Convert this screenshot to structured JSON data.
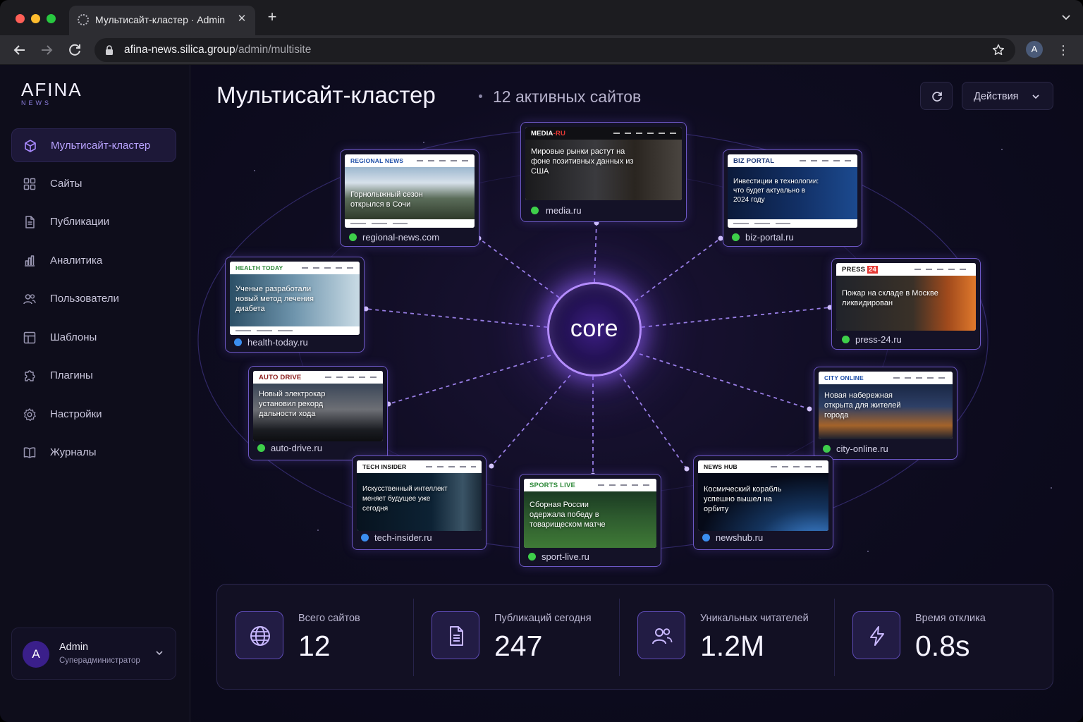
{
  "browser": {
    "tab_title": "Мультисайт-кластер · Admin",
    "url_host": "afina-news.silica.group",
    "url_path": "/admin/multisite",
    "profile_initial": "A"
  },
  "sidebar": {
    "logo": "AFINA",
    "logo_sub": "NEWS",
    "items": [
      {
        "label": "Мультисайт-кластер",
        "icon": "cube-icon",
        "active": true
      },
      {
        "label": "Сайты",
        "icon": "grid-icon"
      },
      {
        "label": "Публикации",
        "icon": "document-icon"
      },
      {
        "label": "Аналитика",
        "icon": "bar-chart-icon"
      },
      {
        "label": "Пользователи",
        "icon": "users-icon"
      },
      {
        "label": "Шаблоны",
        "icon": "layout-icon"
      },
      {
        "label": "Плагины",
        "icon": "puzzle-icon"
      },
      {
        "label": "Настройки",
        "icon": "gear-icon"
      },
      {
        "label": "Журналы",
        "icon": "book-icon"
      }
    ],
    "user": {
      "initial": "A",
      "name": "Admin",
      "role": "Суперадминистратор"
    }
  },
  "header": {
    "title": "Мультисайт-кластер",
    "subtitle": "12 активных сайтов",
    "actions_label": "Действия"
  },
  "cluster": {
    "core_label": "core",
    "sites": [
      {
        "brand": "MEDIA",
        "brand_suffix": "-RU",
        "headline": "Мировые рынки растут на фоне позитивных данных из США",
        "domain": "media.ru",
        "status": "green"
      },
      {
        "brand": "REGIONAL NEWS",
        "headline": "Горнолыжный сезон открылся в Сочи",
        "domain": "regional-news.com",
        "status": "green"
      },
      {
        "brand": "BIZ PORTAL",
        "headline": "Инвестиции в технологии: что будет актуально в 2024 году",
        "domain": "biz-portal.ru",
        "status": "green"
      },
      {
        "brand": "HEALTH TODAY",
        "headline": "Ученые разработали новый метод лечения диабета",
        "domain": "health-today.ru",
        "status": "blue"
      },
      {
        "brand": "PRESS",
        "brand_suffix": "24",
        "headline": "Пожар на складе в Москве ликвидирован",
        "domain": "press-24.ru",
        "status": "green"
      },
      {
        "brand": "AUTO DRIVE",
        "headline": "Новый электрокар установил рекорд дальности хода",
        "domain": "auto-drive.ru",
        "status": "green"
      },
      {
        "brand": "CITY ONLINE",
        "headline": "Новая набережная открыта для жителей города",
        "domain": "city-online.ru",
        "status": "green"
      },
      {
        "brand": "TECH INSIDER",
        "headline": "Искусственный интеллект меняет будущее уже сегодня",
        "domain": "tech-insider.ru",
        "status": "blue"
      },
      {
        "brand": "SPORTS LIVE",
        "headline": "Сборная России одержала победу в товарищеском матче",
        "domain": "sport-live.ru",
        "status": "green"
      },
      {
        "brand": "NEWS HUB",
        "headline": "Космический корабль успешно вышел на орбиту",
        "domain": "newshub.ru",
        "status": "blue"
      }
    ]
  },
  "stats": [
    {
      "label": "Всего сайтов",
      "value": "12",
      "icon": "globe-icon"
    },
    {
      "label": "Публикаций сегодня",
      "value": "247",
      "icon": "document-icon"
    },
    {
      "label": "Уникальных читателей",
      "value": "1.2M",
      "icon": "users-icon"
    },
    {
      "label": "Время отклика",
      "value": "0.8s",
      "icon": "lightning-icon"
    }
  ],
  "colors": {
    "accent": "#a98aff",
    "status_green": "#3ecf4a",
    "status_blue": "#3b8ef0",
    "background": "#0b0a16"
  }
}
